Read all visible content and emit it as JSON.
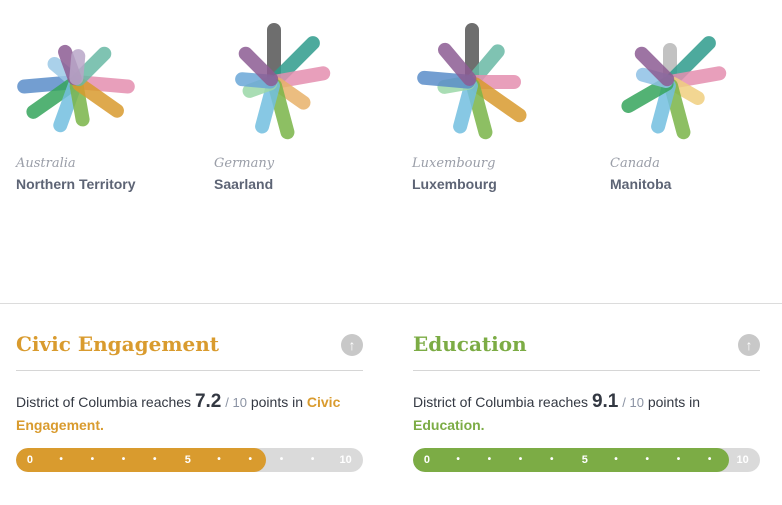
{
  "regions": [
    {
      "country": "Australia",
      "place": "Northern Territory",
      "petals": [
        {
          "c": "#5b8ec9",
          "a": 175,
          "l": 52
        },
        {
          "c": "#9cc9e7",
          "a": 220,
          "l": 28
        },
        {
          "c": "#e58fb0",
          "a": 5,
          "l": 52
        },
        {
          "c": "#36a55c",
          "a": 145,
          "l": 52
        },
        {
          "c": "#73bfe0",
          "a": 110,
          "l": 46
        },
        {
          "c": "#7ab548",
          "a": 80,
          "l": 38
        },
        {
          "c": "#d99b2e",
          "a": 35,
          "l": 50
        },
        {
          "c": "#69b9a5",
          "a": 315,
          "l": 40
        },
        {
          "c": "#8d5c93",
          "a": 250,
          "l": 32
        },
        {
          "c": "#b9a6c8",
          "a": 275,
          "l": 26
        }
      ]
    },
    {
      "country": "Germany",
      "place": "Saarland",
      "petals": [
        {
          "c": "#555555",
          "a": 270,
          "l": 52
        },
        {
          "c": "#2f9c8c",
          "a": 315,
          "l": 55
        },
        {
          "c": "#e58fb0",
          "a": 350,
          "l": 50
        },
        {
          "c": "#e8b26a",
          "a": 35,
          "l": 36
        },
        {
          "c": "#7ab548",
          "a": 75,
          "l": 52
        },
        {
          "c": "#73bfe0",
          "a": 105,
          "l": 46
        },
        {
          "c": "#9bd8a8",
          "a": 160,
          "l": 26
        },
        {
          "c": "#6ba8d8",
          "a": 185,
          "l": 32
        },
        {
          "c": "#8d5c93",
          "a": 225,
          "l": 40
        }
      ]
    },
    {
      "country": "Luxembourg",
      "place": "Luxembourg",
      "petals": [
        {
          "c": "#555555",
          "a": 270,
          "l": 52
        },
        {
          "c": "#69b9a5",
          "a": 310,
          "l": 40
        },
        {
          "c": "#e58fb0",
          "a": 0,
          "l": 42
        },
        {
          "c": "#d99b2e",
          "a": 35,
          "l": 58
        },
        {
          "c": "#7ab548",
          "a": 75,
          "l": 52
        },
        {
          "c": "#73bfe0",
          "a": 105,
          "l": 46
        },
        {
          "c": "#9bd8a8",
          "a": 170,
          "l": 28
        },
        {
          "c": "#5b8ec9",
          "a": 185,
          "l": 48
        },
        {
          "c": "#8d5c93",
          "a": 230,
          "l": 42
        }
      ]
    },
    {
      "country": "Canada",
      "place": "Manitoba",
      "petals": [
        {
          "c": "#b8b8b8",
          "a": 270,
          "l": 32
        },
        {
          "c": "#2f9c8c",
          "a": 315,
          "l": 55
        },
        {
          "c": "#e58fb0",
          "a": 350,
          "l": 50
        },
        {
          "c": "#f0cf80",
          "a": 30,
          "l": 32
        },
        {
          "c": "#7ab548",
          "a": 75,
          "l": 52
        },
        {
          "c": "#73bfe0",
          "a": 105,
          "l": 46
        },
        {
          "c": "#36a55c",
          "a": 150,
          "l": 48
        },
        {
          "c": "#8fc1e6",
          "a": 195,
          "l": 28
        },
        {
          "c": "#8d5c93",
          "a": 225,
          "l": 40
        }
      ]
    }
  ],
  "panels": [
    {
      "title": "Civic Engagement",
      "color": "#d99b2e",
      "sentence_prefix": "District of Columbia reaches",
      "score": "7.2",
      "outof": "/ 10",
      "sentence_mid": "points in",
      "topic": "Civic Engagement.",
      "value": 7.2,
      "max": 10,
      "tick_start": "0",
      "tick_mid": "5",
      "tick_end": "10"
    },
    {
      "title": "Education",
      "color": "#7cac45",
      "sentence_prefix": "District of Columbia reaches",
      "score": "9.1",
      "outof": "/ 10",
      "sentence_mid": "points in",
      "topic": "Education.",
      "value": 9.1,
      "max": 10,
      "tick_start": "0",
      "tick_mid": "5",
      "tick_end": "10"
    }
  ],
  "icons": {
    "scroll_top": "arrow-up-circle-icon",
    "region_chart": "flower-petal-icon"
  }
}
